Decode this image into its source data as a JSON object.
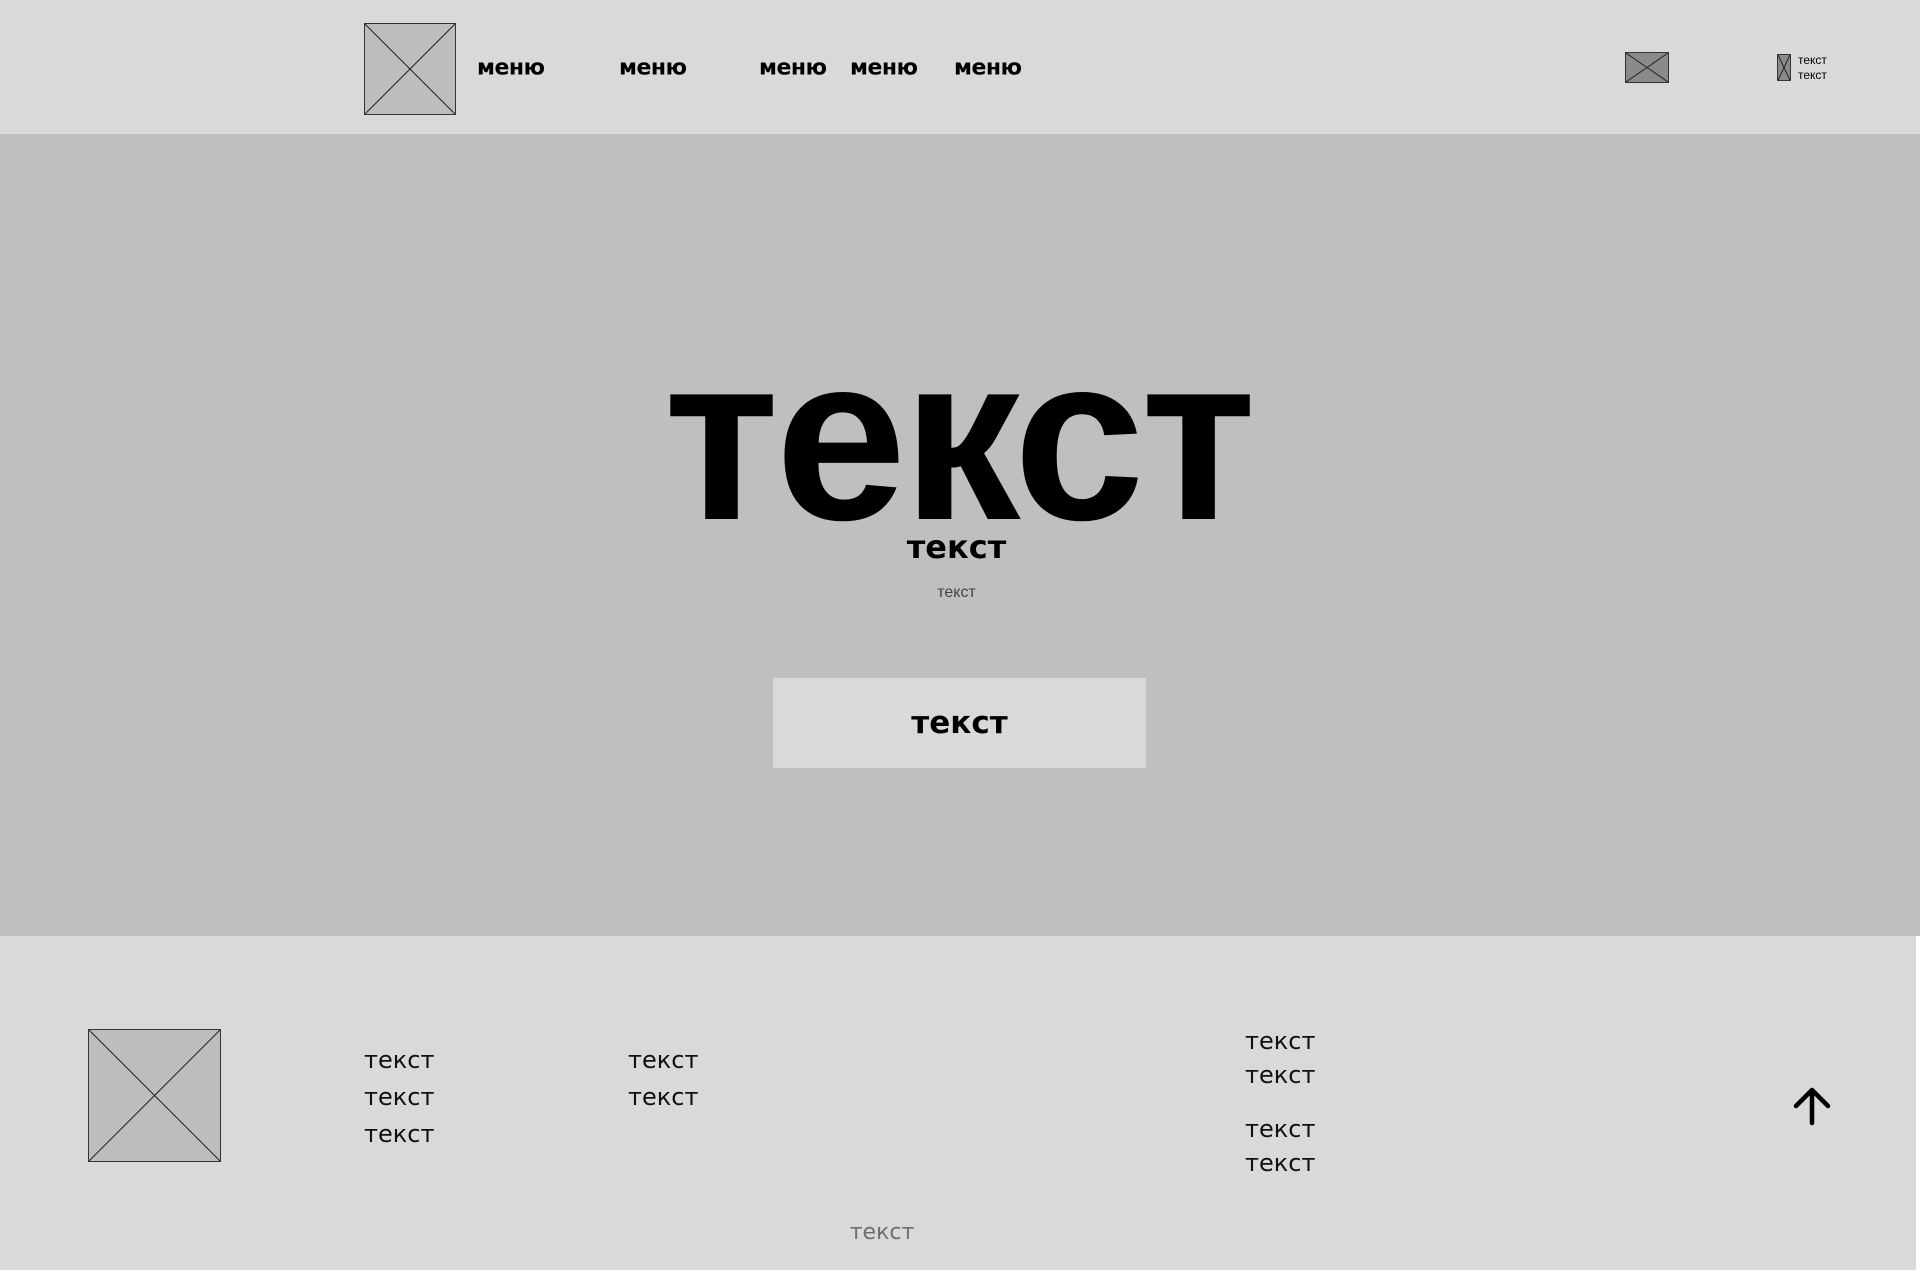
{
  "header": {
    "logo_icon": "image-placeholder-icon",
    "nav": [
      {
        "label": "меню"
      },
      {
        "label": "меню"
      },
      {
        "label": "меню"
      },
      {
        "label": "меню"
      },
      {
        "label": "меню"
      }
    ],
    "header_icon": "image-placeholder-icon",
    "account": {
      "icon": "image-placeholder-icon",
      "line1": "текст",
      "line2": "текст"
    }
  },
  "hero": {
    "title": "текст",
    "subtitle": "текст",
    "caption": "текст",
    "button_label": "текст"
  },
  "footer": {
    "logo_icon": "image-placeholder-icon",
    "col1": [
      "текст",
      "текст",
      "текст"
    ],
    "col2": [
      "текст",
      "текст"
    ],
    "col3": [
      "текст",
      "текст",
      "текст",
      "текст"
    ],
    "back_to_top_icon": "arrow-up-icon",
    "copyright": "текст"
  },
  "colors": {
    "header_bg": "#d9d9d9",
    "hero_bg": "#bfbfbf",
    "footer_bg": "#d9d9d9",
    "button_bg": "#d9d9d9",
    "placeholder": "#bdbdbd",
    "placeholder_dark": "#8a8a8a",
    "text": "#000000",
    "muted_text": "#6e6e6e"
  }
}
